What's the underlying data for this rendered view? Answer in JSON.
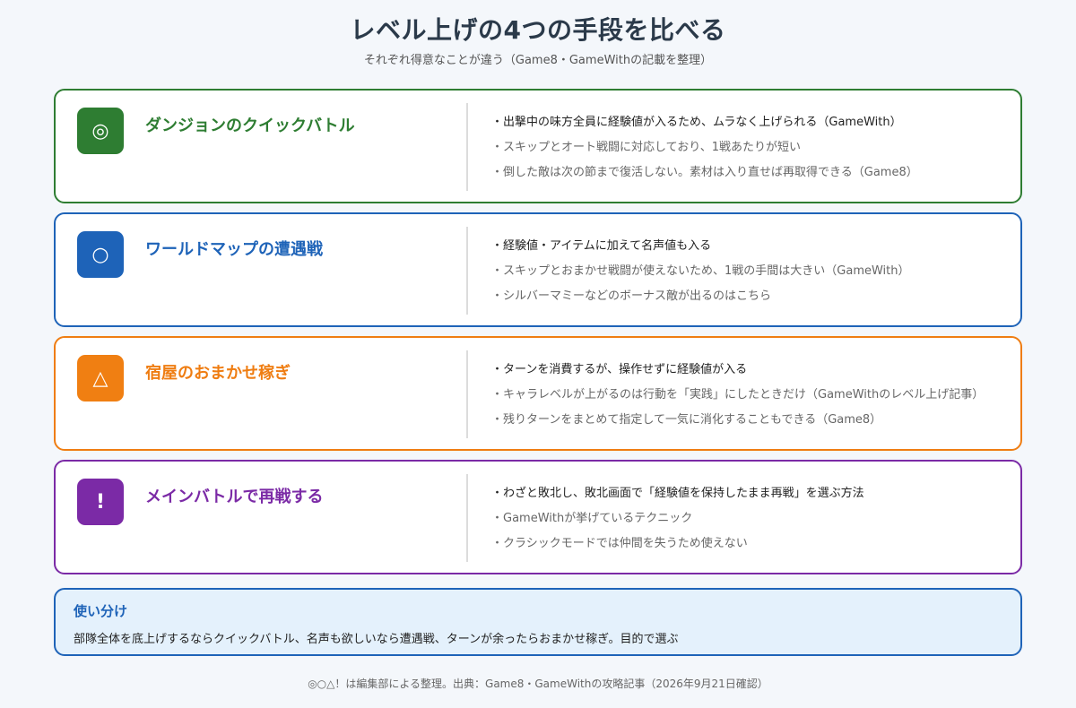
{
  "header": {
    "title": "レベル上げの4つの手段を比べる",
    "subtitle": "それぞれ得意なことが違う（Game8・GameWithの記載を整理）"
  },
  "methods": [
    {
      "badge": "◎",
      "badge_icon": "double-circle-icon",
      "color": "#2e7d32",
      "name": "ダンジョンのクイックバトル",
      "points": [
        "出撃中の味方全員に経験値が入るため、ムラなく上げられる（GameWith）",
        "スキップとオート戦闘に対応しており、1戦あたりが短い",
        "倒した敵は次の節まで復活しない。素材は入り直せば再取得できる（Game8）"
      ]
    },
    {
      "badge": "○",
      "badge_icon": "circle-icon",
      "color": "#1e63b8",
      "name": "ワールドマップの遭遇戦",
      "points": [
        "経験値・アイテムに加えて名声値も入る",
        "スキップとおまかせ戦闘が使えないため、1戦の手間は大きい（GameWith）",
        "シルバーマミーなどのボーナス敵が出るのはこちら"
      ]
    },
    {
      "badge": "△",
      "badge_icon": "triangle-icon",
      "color": "#f07f12",
      "name": "宿屋のおまかせ稼ぎ",
      "points": [
        "ターンを消費するが、操作せずに経験値が入る",
        "キャラレベルが上がるのは行動を「実践」にしたときだけ（GameWithのレベル上げ記事）",
        "残りターンをまとめて指定して一気に消化することもできる（Game8）"
      ]
    },
    {
      "badge": "!",
      "badge_icon": "exclamation-icon",
      "color": "#7b2aa6",
      "name": "メインバトルで再戦する",
      "points": [
        "わざと敗北し、敗北画面で「経験値を保持したまま再戦」を選ぶ方法",
        "GameWithが挙げているテクニック",
        "クラシックモードでは仲間を失うため使えない"
      ]
    }
  ],
  "summary": {
    "title": "使い分け",
    "body": "部隊全体を底上げするならクイックバトル、名声も欲しいなら遭遇戦、ターンが余ったらおまかせ稼ぎ。目的で選ぶ"
  },
  "footer": "◎○△！は編集部による整理。出典：Game8・GameWithの攻略記事（2026年9月21日確認）"
}
